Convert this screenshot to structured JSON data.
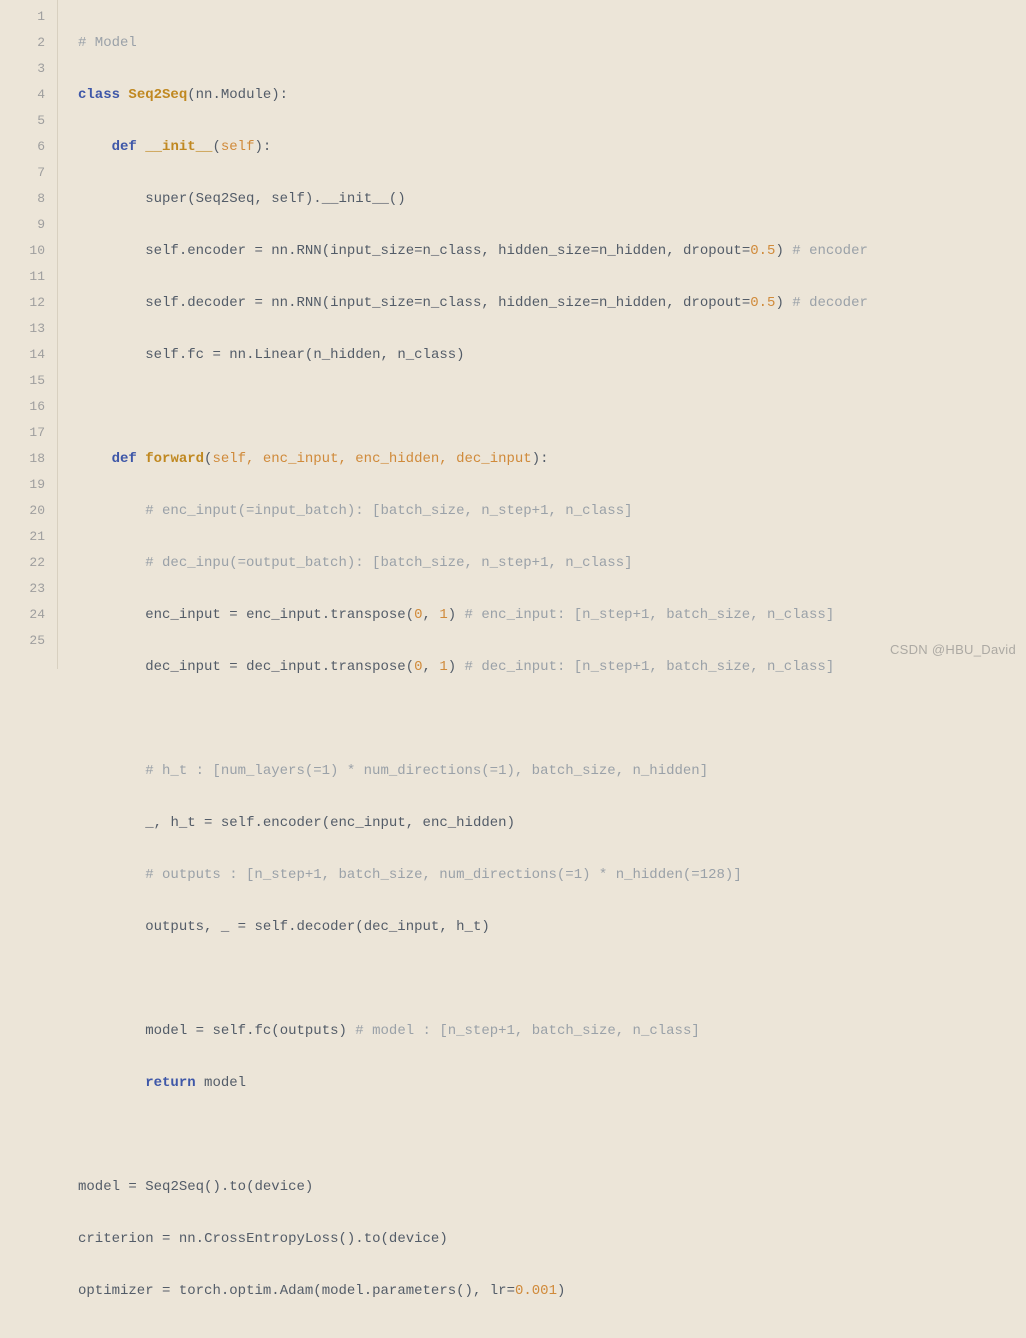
{
  "line_count": 25,
  "watermark": "CSDN @HBU_David",
  "code": {
    "l1_c1": "# Model",
    "l2_kw1": "class",
    "l2_cls": "Seq2Seq",
    "l2_p1": "(",
    "l2_id1": "nn",
    "l2_p2": ".",
    "l2_id2": "Module",
    "l2_p3": "):",
    "l3_kw1": "def",
    "l3_fn": "__init__",
    "l3_p1": "(",
    "l3_prm": "self",
    "l3_p2": "):",
    "l4_id1": "super",
    "l4_p1": "(",
    "l4_id2": "Seq2Seq",
    "l4_p2": ", ",
    "l4_id3": "self",
    "l4_p3": ").",
    "l4_id4": "__init__",
    "l4_p4": "()",
    "l5_id1": "self",
    "l5_p1": ".",
    "l5_id2": "encoder",
    "l5_p2": " = ",
    "l5_id3": "nn",
    "l5_p3": ".",
    "l5_id4": "RNN",
    "l5_p4": "(",
    "l5_id5": "input_size",
    "l5_p5": "=",
    "l5_id6": "n_class",
    "l5_p6": ", ",
    "l5_id7": "hidden_size",
    "l5_p7": "=",
    "l5_id8": "n_hidden",
    "l5_p8": ", ",
    "l5_id9": "dropout",
    "l5_p9": "=",
    "l5_num": "0.5",
    "l5_p10": ")",
    "l5_c": " # encoder",
    "l6_id1": "self",
    "l6_p1": ".",
    "l6_id2": "decoder",
    "l6_p2": " = ",
    "l6_id3": "nn",
    "l6_p3": ".",
    "l6_id4": "RNN",
    "l6_p4": "(",
    "l6_id5": "input_size",
    "l6_p5": "=",
    "l6_id6": "n_class",
    "l6_p6": ", ",
    "l6_id7": "hidden_size",
    "l6_p7": "=",
    "l6_id8": "n_hidden",
    "l6_p8": ", ",
    "l6_id9": "dropout",
    "l6_p9": "=",
    "l6_num": "0.5",
    "l6_p10": ")",
    "l6_c": " # decoder",
    "l7_id1": "self",
    "l7_p1": ".",
    "l7_id2": "fc",
    "l7_p2": " = ",
    "l7_id3": "nn",
    "l7_p3": ".",
    "l7_id4": "Linear",
    "l7_p4": "(",
    "l7_id5": "n_hidden",
    "l7_p5": ", ",
    "l7_id6": "n_class",
    "l7_p6": ")",
    "l9_kw1": "def",
    "l9_fn": "forward",
    "l9_p1": "(",
    "l9_prm": "self, enc_input, enc_hidden, dec_input",
    "l9_p2": "):",
    "l10_c": "# enc_input(=input_batch): [batch_size, n_step+1, n_class]",
    "l11_c": "# dec_inpu(=output_batch): [batch_size, n_step+1, n_class]",
    "l12_id1": "enc_input",
    "l12_p1": " = ",
    "l12_id2": "enc_input",
    "l12_p2": ".",
    "l12_id3": "transpose",
    "l12_p3": "(",
    "l12_n1": "0",
    "l12_p4": ", ",
    "l12_n2": "1",
    "l12_p5": ")",
    "l12_c": " # enc_input: [n_step+1, batch_size, n_class]",
    "l13_id1": "dec_input",
    "l13_p1": " = ",
    "l13_id2": "dec_input",
    "l13_p2": ".",
    "l13_id3": "transpose",
    "l13_p3": "(",
    "l13_n1": "0",
    "l13_p4": ", ",
    "l13_n2": "1",
    "l13_p5": ")",
    "l13_c": " # dec_input: [n_step+1, batch_size, n_class]",
    "l15_c": "# h_t : [num_layers(=1) * num_directions(=1), batch_size, n_hidden]",
    "l16_id1": "_",
    "l16_p1": ", ",
    "l16_id2": "h_t",
    "l16_p2": " = ",
    "l16_id3": "self",
    "l16_p3": ".",
    "l16_id4": "encoder",
    "l16_p4": "(",
    "l16_id5": "enc_input",
    "l16_p5": ", ",
    "l16_id6": "enc_hidden",
    "l16_p6": ")",
    "l17_c": "# outputs : [n_step+1, batch_size, num_directions(=1) * n_hidden(=128)]",
    "l18_id1": "outputs",
    "l18_p1": ", ",
    "l18_id2": "_",
    "l18_p2": " = ",
    "l18_id3": "self",
    "l18_p3": ".",
    "l18_id4": "decoder",
    "l18_p4": "(",
    "l18_id5": "dec_input",
    "l18_p5": ", ",
    "l18_id6": "h_t",
    "l18_p6": ")",
    "l20_id1": "model",
    "l20_p1": " = ",
    "l20_id2": "self",
    "l20_p2": ".",
    "l20_id3": "fc",
    "l20_p3": "(",
    "l20_id4": "outputs",
    "l20_p4": ")",
    "l20_c": " # model : [n_step+1, batch_size, n_class]",
    "l21_kw": "return",
    "l21_id": " model",
    "l23_id1": "model",
    "l23_p1": " = ",
    "l23_id2": "Seq2Seq",
    "l23_p2": "().",
    "l23_id3": "to",
    "l23_p3": "(",
    "l23_id4": "device",
    "l23_p4": ")",
    "l24_id1": "criterion",
    "l24_p1": " = ",
    "l24_id2": "nn",
    "l24_p2": ".",
    "l24_id3": "CrossEntropyLoss",
    "l24_p3": "().",
    "l24_id4": "to",
    "l24_p4": "(",
    "l24_id5": "device",
    "l24_p5": ")",
    "l25_id1": "optimizer",
    "l25_p1": " = ",
    "l25_id2": "torch",
    "l25_p2": ".",
    "l25_id3": "optim",
    "l25_p3": ".",
    "l25_id4": "Adam",
    "l25_p4": "(",
    "l25_id5": "model",
    "l25_p5": ".",
    "l25_id6": "parameters",
    "l25_p6": "(), ",
    "l25_id7": "lr",
    "l25_p7": "=",
    "l25_num": "0.001",
    "l25_p8": ")"
  }
}
